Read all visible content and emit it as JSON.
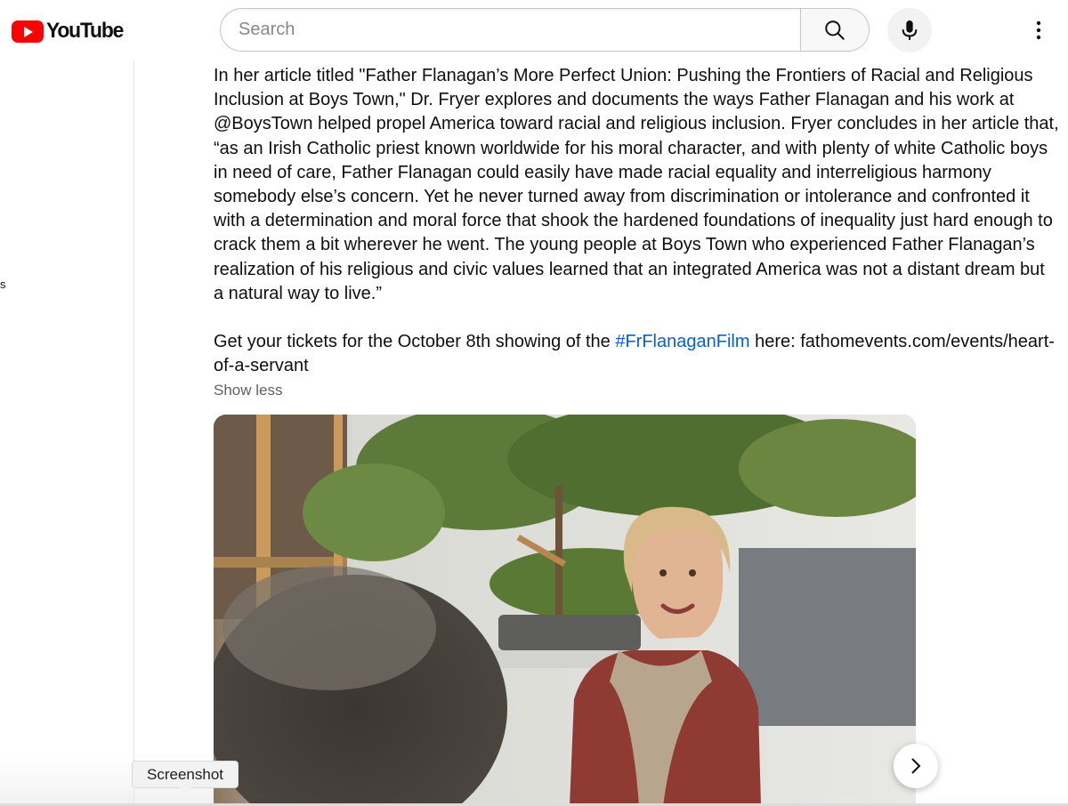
{
  "header": {
    "logo_text": "YouTube",
    "search_placeholder": "Search",
    "search_value": ""
  },
  "sidebar": {
    "fragment_text": "s"
  },
  "description": {
    "paragraph_1": "In her article titled \"Father Flanagan’s More Perfect Union: Pushing the Frontiers of Racial and Religious Inclusion at Boys Town,\" Dr. Fryer explores and documents the ways Father Flanagan and his work at @BoysTown helped propel America toward racial and religious inclusion. Fryer concludes in her article that, “as an Irish Catholic priest known worldwide for his moral character, and with plenty of white Catholic boys in need of care, Father Flanagan could easily have made racial equality and interreligious harmony somebody else’s concern. Yet he never turned away from discrimination or intolerance and confronted it with a determination and moral force that shook the hardened foundations of inequality just hard enough to crack them a bit wherever he went. The young people at Boys Town who experienced Father Flanagan’s realization of his religious and civic values learned that an integrated America was not a distant dream but a natural way to live.”",
    "tickets_prefix": "Get your tickets for the October 8th showing of the ",
    "hashtag": "#FrFlanaganFilm",
    "tickets_suffix": " here: fathomevents.com/events/heart-of-a-servant",
    "show_less_label": "Show less"
  },
  "tooltip": {
    "label": "Screenshot"
  },
  "colors": {
    "brand_red": "#ff0000",
    "link_blue": "#065fd4",
    "secondary_text": "#606060"
  },
  "icons": [
    "youtube-logo-icon",
    "search-icon",
    "microphone-icon",
    "more-vertical-icon",
    "chevron-right-icon"
  ]
}
